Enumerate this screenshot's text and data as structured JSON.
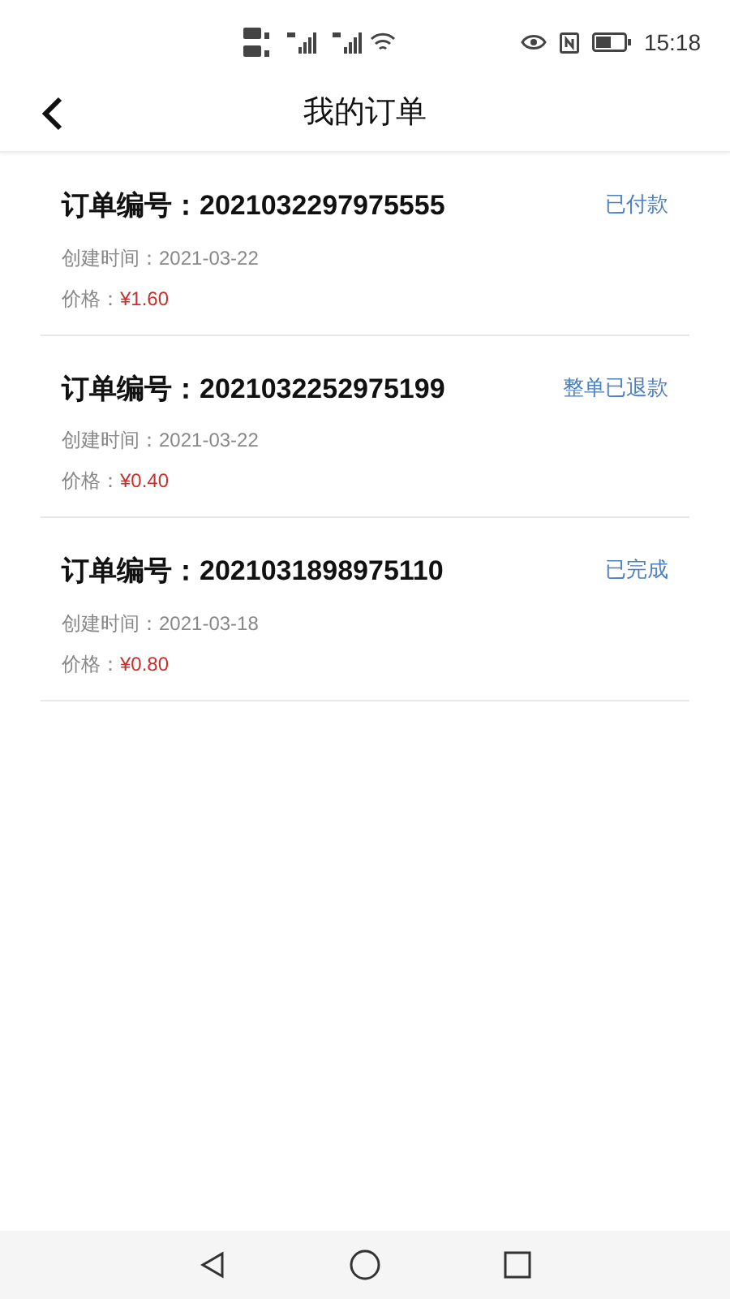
{
  "status_bar": {
    "time": "15:18"
  },
  "header": {
    "title": "我的订单"
  },
  "orders": [
    {
      "number_label": "订单编号：",
      "number": "2021032297975555",
      "status": "已付款",
      "created_label": "创建时间：",
      "created": "2021-03-22",
      "price_label": "价格：",
      "price": "¥1.60"
    },
    {
      "number_label": "订单编号：",
      "number": "2021032252975199",
      "status": "整单已退款",
      "created_label": "创建时间：",
      "created": "2021-03-22",
      "price_label": "价格：",
      "price": "¥0.40"
    },
    {
      "number_label": "订单编号：",
      "number": "2021031898975110",
      "status": "已完成",
      "created_label": "创建时间：",
      "created": "2021-03-18",
      "price_label": "价格：",
      "price": "¥0.80"
    }
  ]
}
